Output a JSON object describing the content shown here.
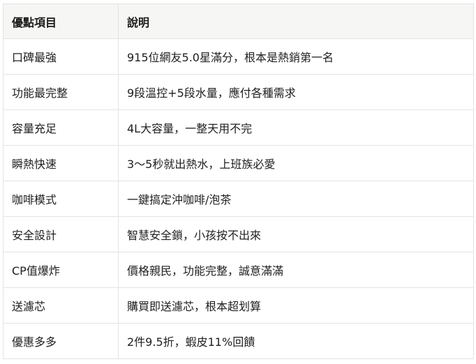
{
  "table": {
    "headers": [
      "優點項目",
      "說明"
    ],
    "rows": [
      {
        "item": "口碑最強",
        "desc": "915位網友5.0星滿分，根本是熱銷第一名"
      },
      {
        "item": "功能最完整",
        "desc": "9段溫控+5段水量，應付各種需求"
      },
      {
        "item": "容量充足",
        "desc": "4L大容量，一整天用不完"
      },
      {
        "item": "瞬熱快速",
        "desc": "3～5秒就出熱水，上班族必愛"
      },
      {
        "item": "咖啡模式",
        "desc": "一鍵搞定沖咖啡/泡茶"
      },
      {
        "item": "安全設計",
        "desc": "智慧安全鎖，小孩按不出來"
      },
      {
        "item": "CP值爆炸",
        "desc": "價格親民，功能完整，誠意滿滿"
      },
      {
        "item": "送濾芯",
        "desc": "購買即送濾芯，根本超划算"
      },
      {
        "item": "優惠多多",
        "desc": "2件9.5折，蝦皮11%回饋"
      }
    ]
  }
}
